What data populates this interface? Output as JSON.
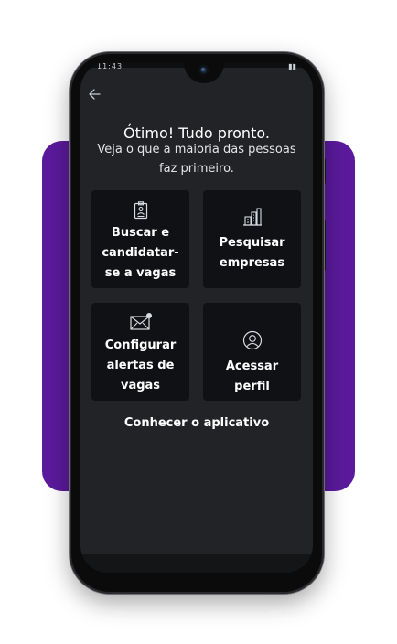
{
  "status_bar": {
    "time": "11:43",
    "right_icons": "signal-battery"
  },
  "header": {
    "back_icon": "arrow-left-icon"
  },
  "onboarding": {
    "title": "Ótimo! Tudo pronto.",
    "subtitle": "Veja o que a maioria das pessoas faz primeiro."
  },
  "cards": [
    {
      "label": "Buscar e candidatar-se a vagas",
      "icon": "id-badge-icon"
    },
    {
      "label": "Pesquisar empresas",
      "icon": "buildings-icon"
    },
    {
      "label": "Configurar alertas de vagas",
      "icon": "mail-alert-icon"
    },
    {
      "label": "Acessar perfil",
      "icon": "user-circle-icon"
    }
  ],
  "footer_link": "Conhecer o aplicativo",
  "colors": {
    "accent_bg": "#5b1a9c",
    "screen_bg": "#212326",
    "card_bg": "#0f1114",
    "text": "#ffffff"
  }
}
